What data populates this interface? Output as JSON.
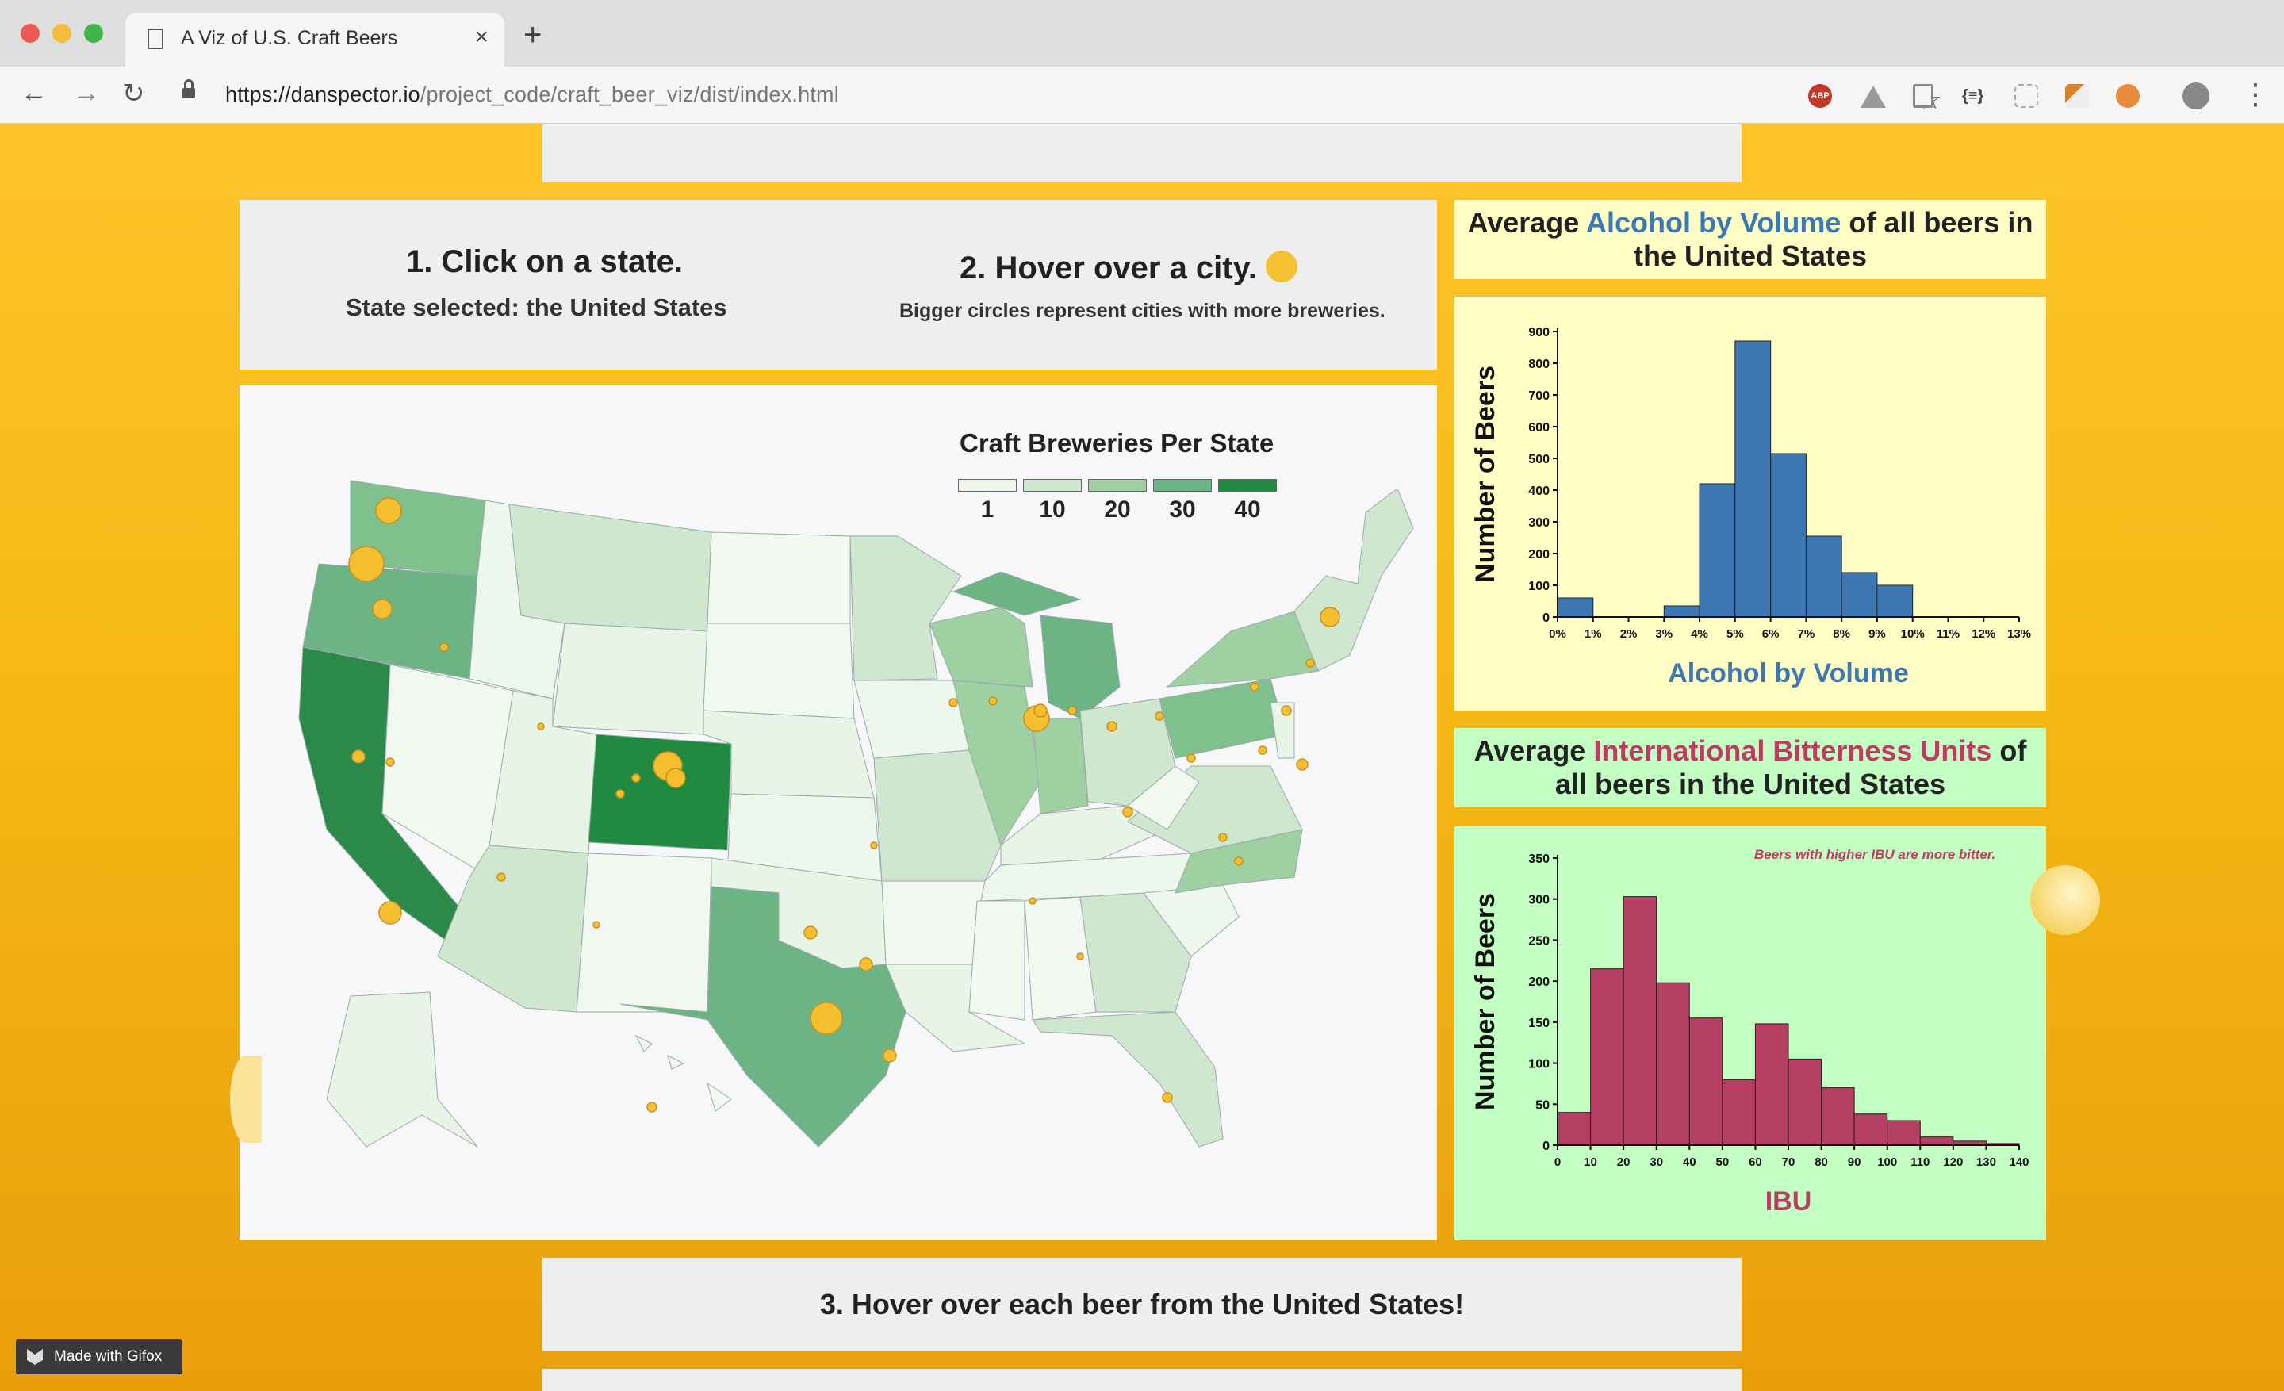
{
  "browser": {
    "tab_title": "A Viz of U.S. Craft Beers",
    "tab_close": "×",
    "new_tab": "+",
    "url_host": "https://danspector.io",
    "url_path": "/project_code/craft_beer_viz/dist/index.html",
    "star": "☆",
    "back": "←",
    "forward": "→",
    "reload": "↻",
    "menu": "⋮",
    "extensions": [
      "abp-icon",
      "drive-icon",
      "doc-icon",
      "json-icon",
      "grid-icon",
      "tool-icon",
      "owl-icon"
    ],
    "abp_label": "ABP",
    "json_label": "{≡}"
  },
  "steps": {
    "step1_title": "1. Click on a state.",
    "step1_sub": "State selected: the United States",
    "step2_title": "2. Hover over a city.",
    "step2_sub": "Bigger circles represent cities with more breweries.",
    "step3_title": "3. Hover over each beer from the United States!"
  },
  "map": {
    "title": "Craft Breweries Per State",
    "legend": [
      "1",
      "10",
      "20",
      "30",
      "40"
    ],
    "legend_colors": [
      "#edf7ec",
      "#cfe6cf",
      "#9fd0a2",
      "#6cb484",
      "#1f8a40"
    ]
  },
  "abv": {
    "title_pre": "Average ",
    "title_word": "Alcohol by Volume",
    "title_post": " of all beers in the United States"
  },
  "ibu": {
    "title_pre": "Average ",
    "title_word": "International Bitterness Units",
    "title_post": " of all beers in the United States",
    "note": "Beers with higher IBU are more bitter."
  },
  "chart_data": [
    {
      "type": "bar",
      "xlabel": "Alcohol by Volume",
      "ylabel": "Number of Beers",
      "x_ticks": [
        "0%",
        "1%",
        "2%",
        "3%",
        "4%",
        "5%",
        "6%",
        "7%",
        "8%",
        "9%",
        "10%",
        "11%",
        "12%",
        "13%"
      ],
      "bins": [
        [
          0,
          1
        ],
        [
          1,
          2
        ],
        [
          2,
          3
        ],
        [
          3,
          4
        ],
        [
          4,
          5
        ],
        [
          5,
          6
        ],
        [
          6,
          7
        ],
        [
          7,
          8
        ],
        [
          8,
          9
        ],
        [
          9,
          10
        ],
        [
          10,
          11
        ],
        [
          11,
          12
        ],
        [
          12,
          13
        ]
      ],
      "values": [
        60,
        0,
        0,
        35,
        420,
        870,
        515,
        255,
        140,
        100,
        0,
        0,
        0
      ],
      "y_ticks": [
        0,
        100,
        200,
        300,
        400,
        500,
        600,
        700,
        800,
        900
      ],
      "ylim": [
        0,
        900
      ],
      "color": "#3d78b5",
      "background": "#fffcc4"
    },
    {
      "type": "bar",
      "xlabel": "IBU",
      "ylabel": "Number of Beers",
      "x_ticks": [
        "0",
        "10",
        "20",
        "30",
        "40",
        "50",
        "60",
        "70",
        "80",
        "90",
        "100",
        "110",
        "120",
        "130",
        "140"
      ],
      "bins": [
        [
          0,
          10
        ],
        [
          10,
          20
        ],
        [
          20,
          30
        ],
        [
          30,
          40
        ],
        [
          40,
          50
        ],
        [
          50,
          60
        ],
        [
          60,
          70
        ],
        [
          70,
          80
        ],
        [
          80,
          90
        ],
        [
          90,
          100
        ],
        [
          100,
          110
        ],
        [
          110,
          120
        ],
        [
          120,
          130
        ],
        [
          130,
          140
        ]
      ],
      "values": [
        40,
        215,
        303,
        198,
        155,
        80,
        148,
        105,
        70,
        38,
        30,
        10,
        5,
        2
      ],
      "y_ticks": [
        0,
        50,
        100,
        150,
        200,
        250,
        300,
        350
      ],
      "ylim": [
        0,
        350
      ],
      "color": "#b43f63",
      "background": "#c3ffc3"
    }
  ],
  "gifox": "Made with Gifox"
}
